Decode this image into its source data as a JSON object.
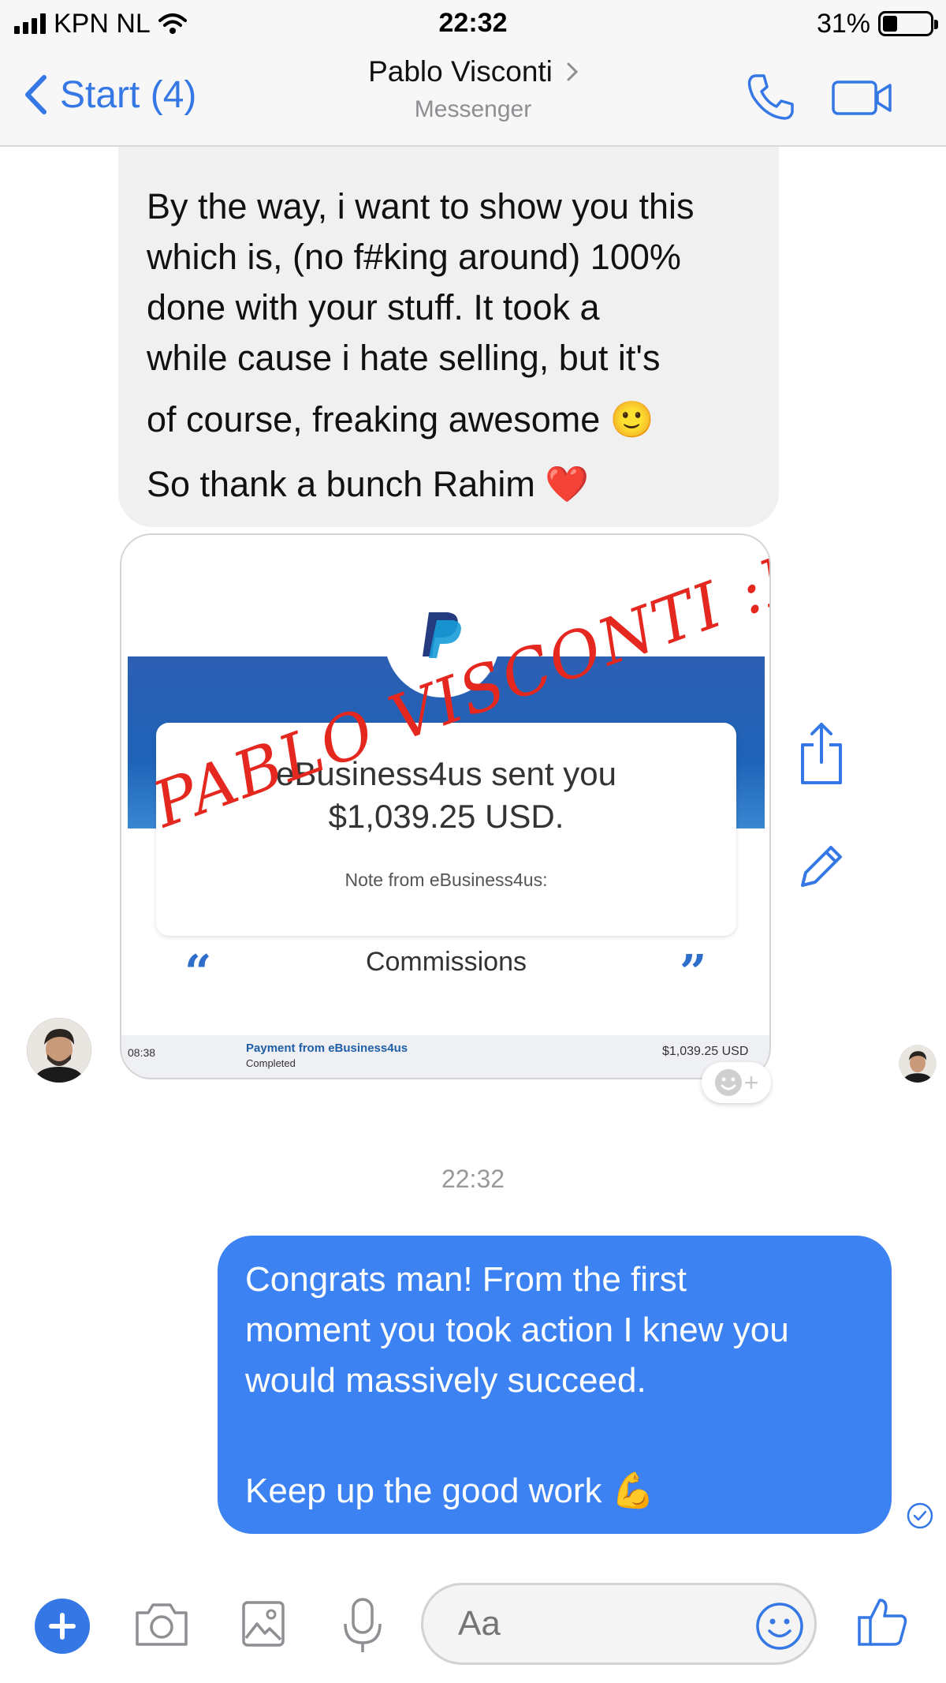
{
  "status_bar": {
    "carrier": "KPN NL",
    "time": "22:32",
    "battery": "31%",
    "battery_level": 0.31
  },
  "nav": {
    "back_label": "Start (4)",
    "title": "Pablo Visconti",
    "subtitle": "Messenger"
  },
  "incoming": {
    "lines": [
      "By the way, i want to show you this",
      "which is, (no f#king around) 100%",
      "done with your stuff. It took a",
      "while cause i hate selling, but  it's",
      "of course, freaking awesome 🙂",
      "So thank a bunch Rahim ❤️"
    ]
  },
  "payment_card": {
    "sent_line1": "eBusiness4us sent you",
    "sent_line2": "$1,039.25 USD.",
    "note": "Note from eBusiness4us:",
    "comment": "Commissions",
    "quote_open": "“",
    "quote_close": "”",
    "footer_time": "08:38",
    "footer_title": "Payment from eBusiness4us",
    "footer_status": "Completed",
    "footer_amount": "$1,039.25 USD",
    "watermark": "PABLO VISCONTI :D"
  },
  "reaction": {
    "plus": "+"
  },
  "timestamp": "22:32",
  "outgoing": {
    "lines": [
      "Congrats man! From the first",
      "moment you took action I knew you",
      "would massively succeed.",
      "",
      "Keep up the good work 💪"
    ]
  },
  "composer": {
    "placeholder": "Aa"
  },
  "colors": {
    "accent": "#3578e5",
    "outgoing_bubble": "#3c82f3",
    "incoming_bubble": "#f0f0f0",
    "paypal_band": "#1e63b8",
    "watermark": "#e5281f"
  },
  "icons": [
    "chevron-left-icon",
    "chevron-right-icon",
    "phone-icon",
    "video-icon",
    "share-icon",
    "edit-icon",
    "add-reaction-icon",
    "read-receipt-icon",
    "plus-icon",
    "camera-icon",
    "image-icon",
    "microphone-icon",
    "emoji-icon",
    "like-icon"
  ]
}
